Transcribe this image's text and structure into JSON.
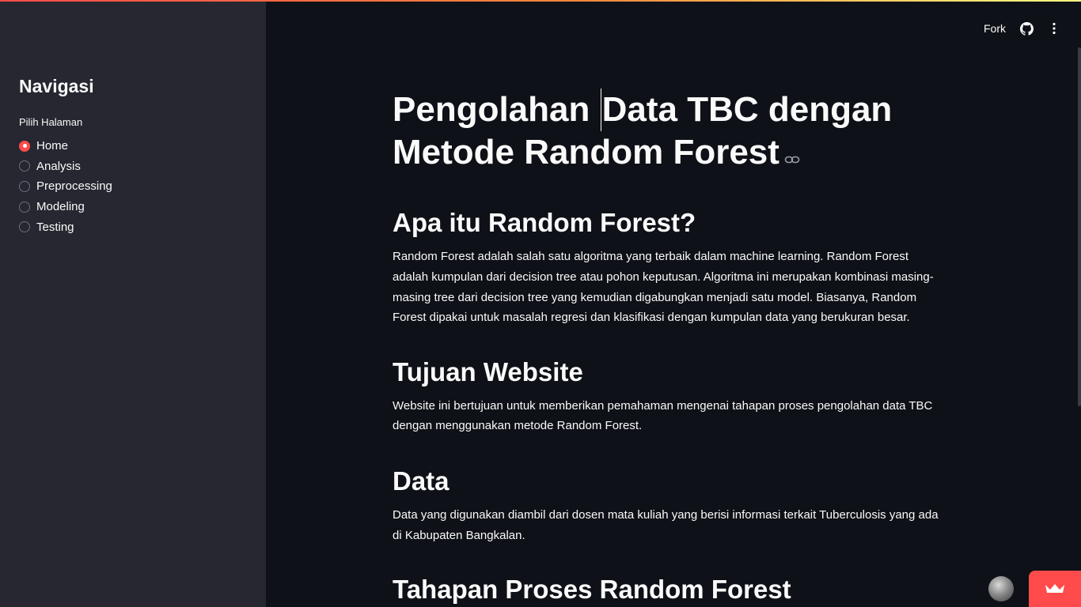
{
  "sidebar": {
    "title": "Navigasi",
    "radio_label": "Pilih Halaman",
    "options": [
      "Home",
      "Analysis",
      "Preprocessing",
      "Modeling",
      "Testing"
    ],
    "selected": "Home"
  },
  "header": {
    "fork_label": "Fork",
    "icons": [
      "github-icon",
      "more-vertical-icon"
    ]
  },
  "main": {
    "title_part1": "Pengolahan ",
    "title_part2": "Data TBC dengan Metode Random Forest",
    "sections": [
      {
        "heading": "Apa itu Random Forest?",
        "text": "Random Forest adalah salah satu algoritma yang terbaik dalam machine learning. Random Forest adalah kumpulan dari decision tree atau pohon keputusan. Algoritma ini merupakan kombinasi masing-masing tree dari decision tree yang kemudian digabungkan menjadi satu model. Biasanya, Random Forest dipakai untuk masalah regresi dan klasifikasi dengan kumpulan data yang berukuran besar."
      },
      {
        "heading": "Tujuan Website",
        "text": "Website ini bertujuan untuk memberikan pemahaman mengenai tahapan proses pengolahan data TBC dengan menggunakan metode Random Forest."
      },
      {
        "heading": "Data",
        "text": "Data yang digunakan diambil dari dosen mata kuliah yang berisi informasi terkait Tuberculosis yang ada di Kabupaten Bangkalan."
      },
      {
        "heading": "Tahapan Proses Random Forest",
        "text": ""
      }
    ]
  },
  "colors": {
    "accent": "#ff4b4b",
    "background": "#0e1117",
    "sidebar": "#262730",
    "text": "#fafafa"
  }
}
